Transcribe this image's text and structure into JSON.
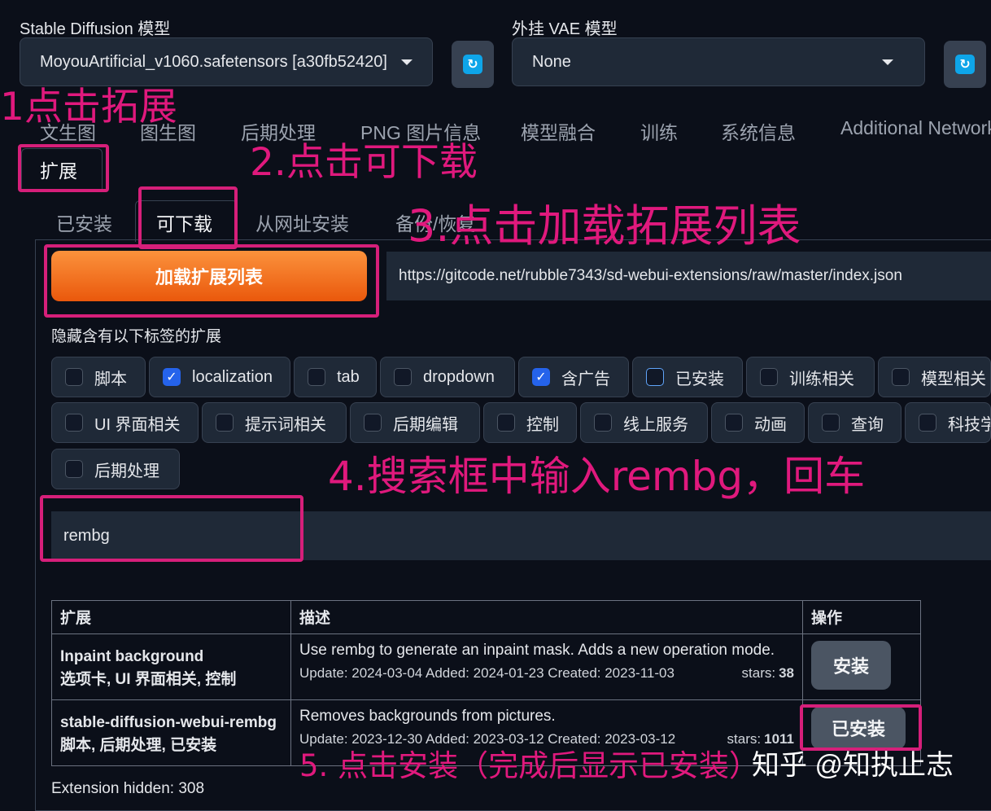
{
  "models": {
    "sd_label": "Stable Diffusion 模型",
    "sd_value": "MoyouArtificial_v1060.safetensors [a30fb52420]",
    "vae_label": "外挂 VAE 模型",
    "vae_value": "None"
  },
  "main_tabs": [
    "文生图",
    "图生图",
    "后期处理",
    "PNG 图片信息",
    "模型融合",
    "训练",
    "系统信息",
    "Additional Networks",
    "扩展"
  ],
  "sub_tabs": [
    "已安装",
    "可下载",
    "从网址安装",
    "备份/恢复"
  ],
  "load_button_label": "加载扩展列表",
  "index_url": "https://gitcode.net/rubble7343/sd-webui-extensions/raw/master/index.json",
  "hide_label": "隐藏含有以下标签的扩展",
  "tag_filters": [
    {
      "label": "脚本",
      "checked": false
    },
    {
      "label": "localization",
      "checked": true
    },
    {
      "label": "tab",
      "checked": false
    },
    {
      "label": "dropdown",
      "checked": false
    },
    {
      "label": "含广告",
      "checked": true
    },
    {
      "label": "已安装",
      "checked": false
    },
    {
      "label": "训练相关",
      "checked": false
    },
    {
      "label": "模型相关",
      "checked": false
    },
    {
      "label": "UI 界面相关",
      "checked": false
    },
    {
      "label": "提示词相关",
      "checked": false
    },
    {
      "label": "后期编辑",
      "checked": false
    },
    {
      "label": "控制",
      "checked": false
    },
    {
      "label": "线上服务",
      "checked": false
    },
    {
      "label": "动画",
      "checked": false
    },
    {
      "label": "查询",
      "checked": false
    },
    {
      "label": "科技学术",
      "checked": false
    },
    {
      "label": "后期处理",
      "checked": false
    }
  ],
  "search_value": "rembg",
  "table": {
    "headers": [
      "扩展",
      "描述",
      "操作"
    ],
    "rows": [
      {
        "name": "Inpaint background",
        "tags": "选项卡, UI 界面相关, 控制",
        "description": "Use rembg to generate an inpaint mask. Adds a new operation mode.",
        "dates": "Update: 2024-03-04 Added: 2024-01-23 Created: 2023-11-03",
        "stars_label": "stars:",
        "stars": "38",
        "action": "安装"
      },
      {
        "name": "stable-diffusion-webui-rembg",
        "tags": "脚本, 后期处理, 已安装",
        "description": "Removes backgrounds from pictures.",
        "dates": "Update: 2023-12-30 Added: 2023-03-12 Created: 2023-03-12",
        "stars_label": "stars:",
        "stars": "1011",
        "action": "已安装"
      }
    ]
  },
  "hidden_count_text": "Extension hidden: 308",
  "annotations": {
    "step1": "1点击拓展",
    "step2": "2.点击可下载",
    "step3": "3.点击加载拓展列表",
    "step4": "4.搜索框中输入rembg，回车",
    "step5": "5. 点击安装（完成后显示已安装）"
  },
  "watermark": "知乎 @知执止志",
  "colors": {
    "background": "#0b0f19",
    "panel": "#1f2937",
    "accent_orange": "#f97316",
    "checkbox_blue": "#2563eb",
    "annotation_magenta": "#e0197d",
    "refresh_icon": "#0ea5e9"
  },
  "icons": [
    "refresh-icon",
    "chevron-down-icon",
    "check-icon"
  ]
}
